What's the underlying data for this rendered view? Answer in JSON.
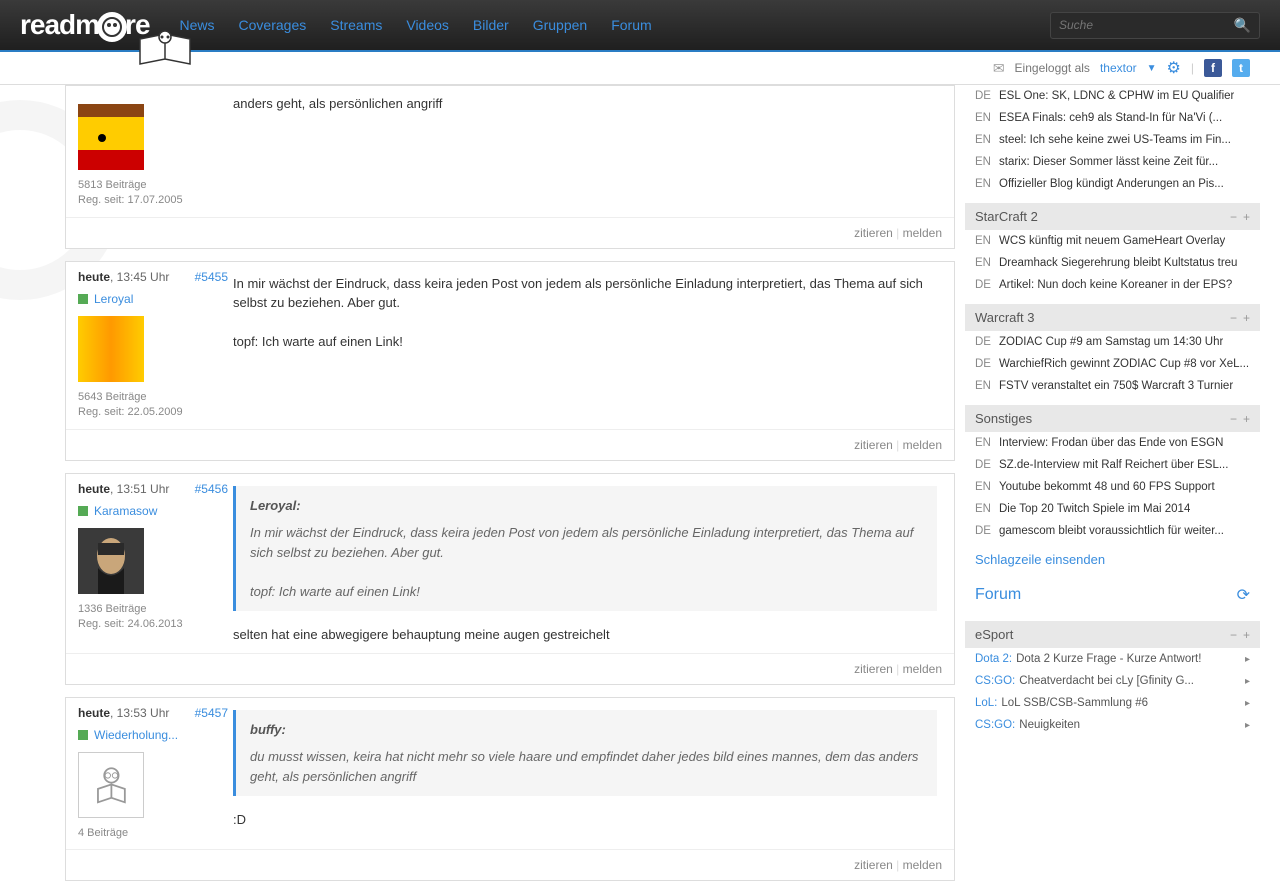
{
  "header": {
    "logo": "readmore",
    "nav": [
      "News",
      "Coverages",
      "Streams",
      "Videos",
      "Bilder",
      "Gruppen",
      "Forum"
    ],
    "search_placeholder": "Suche"
  },
  "subheader": {
    "logged_in_as": "Eingeloggt als",
    "username": "thextor"
  },
  "posts": [
    {
      "time_prefix": "",
      "time": "",
      "postnum": "",
      "username": "",
      "avatar_type": "chicken",
      "stats1": "5813 Beiträge",
      "stats2": "Reg. seit: 17.07.2005",
      "body": "anders geht, als persönlichen angriff",
      "quote": null
    },
    {
      "time_prefix": "heute",
      "time": ", 13:45 Uhr",
      "postnum": "#5455",
      "username": "Leroyal",
      "avatar_type": "multi",
      "stats1": "5643 Beiträge",
      "stats2": "Reg. seit: 22.05.2009",
      "body": "In mir wächst der Eindruck, dass keira jeden Post von jedem als persönliche Einladung interpretiert, das Thema auf sich selbst zu beziehen. Aber gut.\n\ntopf: Ich warte auf einen Link!",
      "quote": null
    },
    {
      "time_prefix": "heute",
      "time": ", 13:51 Uhr",
      "postnum": "#5456",
      "username": "Karamasow",
      "avatar_type": "man",
      "stats1": "1336 Beiträge",
      "stats2": "Reg. seit: 24.06.2013",
      "body": "selten hat eine abwegigere behauptung meine augen gestreichelt",
      "quote": {
        "author": "Leroyal:",
        "text": "In mir wächst der Eindruck, dass keira jeden Post von jedem als persönliche Einladung interpretiert, das Thema auf sich selbst zu beziehen. Aber gut.\n\ntopf: Ich warte auf einen Link!"
      }
    },
    {
      "time_prefix": "heute",
      "time": ", 13:53 Uhr",
      "postnum": "#5457",
      "username": "Wiederholung...",
      "avatar_type": "default",
      "stats1": "4 Beiträge",
      "stats2": "",
      "body": ":D",
      "quote": {
        "author": "buffy:",
        "text": "du musst wissen, keira hat nicht mehr so viele haare und empfindet daher jedes bild eines mannes, dem das anders geht, als persönlichen angriff"
      }
    }
  ],
  "post_actions": {
    "quote": "zitieren",
    "report": "melden"
  },
  "sidebar": {
    "top_items": [
      {
        "lang": "DE",
        "text": "ESL One: SK, LDNC & CPHW im EU Qualifier"
      },
      {
        "lang": "EN",
        "text": "ESEA Finals: ceh9 als Stand-In für Na'Vi (..."
      },
      {
        "lang": "EN",
        "text": "steel: Ich sehe keine zwei US-Teams im Fin..."
      },
      {
        "lang": "EN",
        "text": "starix: Dieser Sommer lässt keine Zeit für..."
      },
      {
        "lang": "EN",
        "text": "Offizieller Blog kündigt Änderungen an Pis..."
      }
    ],
    "sections": [
      {
        "title": "StarCraft 2",
        "items": [
          {
            "lang": "EN",
            "text": "WCS künftig mit neuem GameHeart Overlay"
          },
          {
            "lang": "EN",
            "text": "Dreamhack Siegerehrung bleibt Kultstatus treu"
          },
          {
            "lang": "DE",
            "text": "Artikel: Nun doch keine Koreaner in der EPS?"
          }
        ]
      },
      {
        "title": "Warcraft 3",
        "items": [
          {
            "lang": "DE",
            "text": "ZODIAC Cup #9 am Samstag um 14:30 Uhr"
          },
          {
            "lang": "DE",
            "text": "WarchiefRich gewinnt ZODIAC Cup #8 vor XeL..."
          },
          {
            "lang": "EN",
            "text": "FSTV veranstaltet ein 750$ Warcraft 3 Turnier"
          }
        ]
      },
      {
        "title": "Sonstiges",
        "items": [
          {
            "lang": "EN",
            "text": "Interview: Frodan über das Ende von ESGN"
          },
          {
            "lang": "DE",
            "text": "SZ.de-Interview mit Ralf Reichert über ESL..."
          },
          {
            "lang": "EN",
            "text": "Youtube bekommt 48 und 60 FPS Support"
          },
          {
            "lang": "EN",
            "text": "Die Top 20 Twitch Spiele im Mai 2014"
          },
          {
            "lang": "DE",
            "text": "gamescom bleibt voraussichtlich für weiter..."
          }
        ]
      }
    ],
    "submit_link": "Schlagzeile einsenden",
    "forum_heading": "Forum",
    "forum_section": "eSport",
    "forum_items": [
      {
        "cat": "Dota 2:",
        "title": "Dota 2 Kurze Frage - Kurze Antwort!"
      },
      {
        "cat": "CS:GO:",
        "title": "Cheatverdacht bei cLy [Gfinity G..."
      },
      {
        "cat": "LoL:",
        "title": "LoL SSB/CSB-Sammlung #6"
      },
      {
        "cat": "CS:GO:",
        "title": "Neuigkeiten"
      }
    ]
  }
}
